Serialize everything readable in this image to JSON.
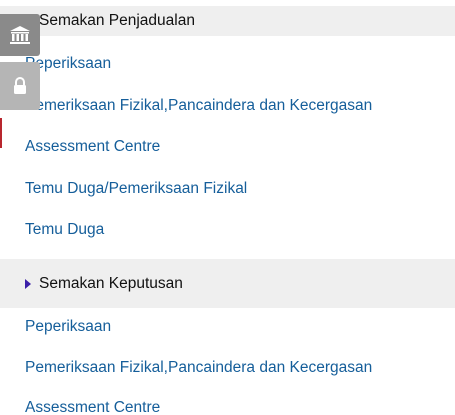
{
  "sections": [
    {
      "title": "Semakan Penjadualan",
      "links": [
        "Peperiksaan",
        "Pemeriksaan Fizikal,Pancaindera dan Kecergasan",
        "Assessment Centre",
        "Temu Duga/Pemeriksaan Fizikal",
        "Temu Duga"
      ]
    },
    {
      "title": "Semakan Keputusan",
      "links": [
        "Peperiksaan",
        "Pemeriksaan Fizikal,Pancaindera dan Kecergasan",
        "Assessment Centre"
      ]
    }
  ],
  "side_tabs": [
    {
      "icon": "bank-icon"
    },
    {
      "icon": "lock-icon"
    }
  ],
  "colors": {
    "link": "#155e9a",
    "header_bg": "#efefef",
    "triangle": "#3b1fa8",
    "side_tab": "#8c8c8c"
  }
}
